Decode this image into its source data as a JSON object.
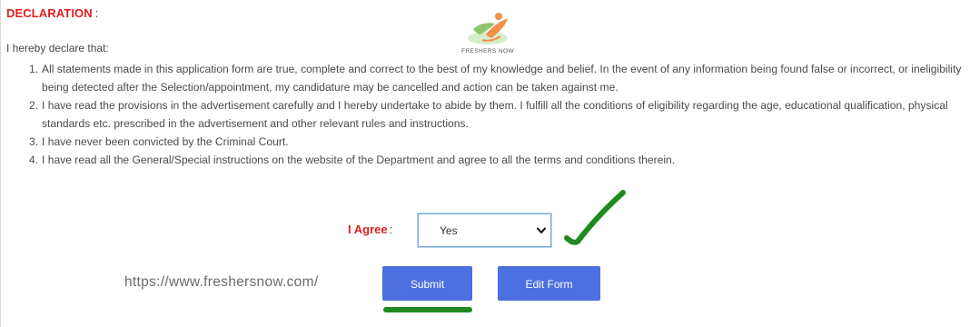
{
  "declaration": {
    "heading": "DECLARATION",
    "heading_suffix": ":",
    "intro": "I hereby declare that:",
    "items": [
      {
        "num": "1.",
        "text": "All statements made in this application form are true, complete and correct to the best of my knowledge and belief. In the event of any information being found false or incorrect, or ineligibility being detected after the Selection/appointment, my candidature may be cancelled and action can be taken against me."
      },
      {
        "num": "2.",
        "text": "I have read the provisions in the advertisement carefully and I hereby undertake to abide by them. I fulfill all the conditions of eligibility regarding the age, educational qualification, physical standards etc. prescribed in the advertisement and other relevant rules and instructions."
      },
      {
        "num": "3.",
        "text": "I have never been convicted by the Criminal Court."
      },
      {
        "num": "4.",
        "text": "I have read all the General/Special instructions on the website of the Department and agree to all the terms and conditions therein."
      }
    ]
  },
  "logo": {
    "text": "FRESHERS NOW",
    "colors": {
      "orange": "#f0914a",
      "green": "#8fc46a"
    }
  },
  "agree": {
    "label": "I Agree",
    "label_suffix": ":",
    "selected": "Yes"
  },
  "watermark": {
    "url": "https://www.freshersnow.com/"
  },
  "buttons": {
    "submit": "Submit",
    "edit": "Edit Form"
  },
  "colors": {
    "heading_red": "#e01f1f",
    "button_blue": "#4e6fe0",
    "annotation_green": "#1f8a1f"
  },
  "icons": {
    "check": "checkmark-annotation-icon",
    "caret": "chevron-down-icon"
  }
}
